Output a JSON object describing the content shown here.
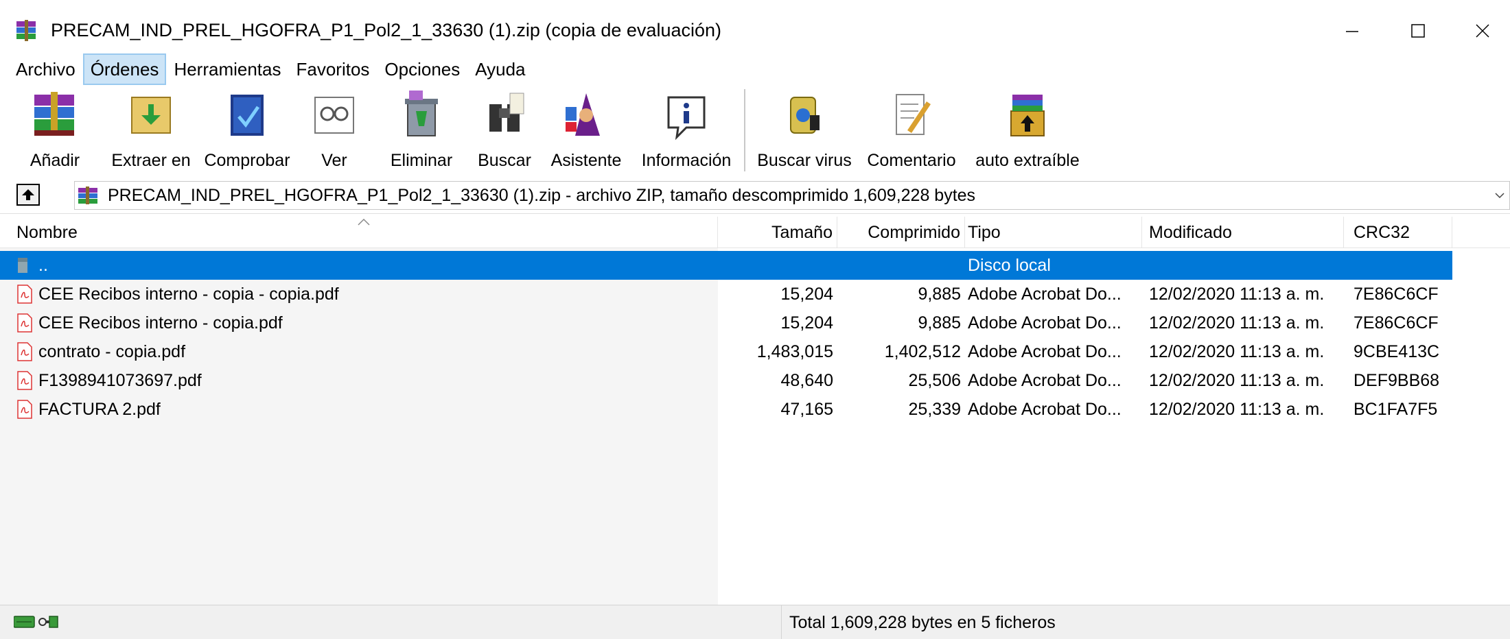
{
  "window": {
    "title": "PRECAM_IND_PREL_HGOFRA_P1_Pol2_1_33630 (1).zip (copia de evaluación)",
    "app_icon": "winrar-books-icon",
    "controls": [
      "minimize-icon",
      "maximize-icon",
      "close-icon"
    ]
  },
  "menu": [
    {
      "label": "Archivo",
      "active": false
    },
    {
      "label": "Órdenes",
      "active": true
    },
    {
      "label": "Herramientas",
      "active": false
    },
    {
      "label": "Favoritos",
      "active": false
    },
    {
      "label": "Opciones",
      "active": false
    },
    {
      "label": "Ayuda",
      "active": false
    }
  ],
  "toolbar": [
    {
      "label": "Añadir",
      "icon": "add-archive-icon"
    },
    {
      "label": "Extraer en",
      "icon": "extract-to-icon"
    },
    {
      "label": "Comprobar",
      "icon": "test-archive-icon"
    },
    {
      "label": "Ver",
      "icon": "view-glasses-icon"
    },
    {
      "label": "Eliminar",
      "icon": "delete-bin-icon"
    },
    {
      "label": "Buscar",
      "icon": "binoculars-icon"
    },
    {
      "label": "Asistente",
      "icon": "wizard-icon"
    },
    {
      "label": "Información",
      "icon": "info-icon"
    },
    {
      "label": "Buscar virus",
      "icon": "virus-scan-icon"
    },
    {
      "label": "Comentario",
      "icon": "comment-icon"
    },
    {
      "label": "auto extraíble",
      "icon": "self-extract-icon"
    }
  ],
  "address": {
    "text": "PRECAM_IND_PREL_HGOFRA_P1_Pol2_1_33630 (1).zip - archivo ZIP, tamaño descomprimido 1,609,228 bytes"
  },
  "columns": {
    "name": "Nombre",
    "size": "Tamaño",
    "packed": "Comprimido",
    "type": "Tipo",
    "modified": "Modificado",
    "crc": "CRC32"
  },
  "rows": [
    {
      "name": "..",
      "size": "",
      "packed": "",
      "type": "Disco local",
      "modified": "",
      "crc": "",
      "icon": "parent-folder-icon",
      "selected": true
    },
    {
      "name": "CEE Recibos interno - copia - copia.pdf",
      "size": "15,204",
      "packed": "9,885",
      "type": "Adobe Acrobat Do...",
      "modified": "12/02/2020 11:13 a. m.",
      "crc": "7E86C6CF",
      "icon": "pdf-file-icon",
      "selected": false
    },
    {
      "name": "CEE Recibos interno - copia.pdf",
      "size": "15,204",
      "packed": "9,885",
      "type": "Adobe Acrobat Do...",
      "modified": "12/02/2020 11:13 a. m.",
      "crc": "7E86C6CF",
      "icon": "pdf-file-icon",
      "selected": false
    },
    {
      "name": "contrato - copia.pdf",
      "size": "1,483,015",
      "packed": "1,402,512",
      "type": "Adobe Acrobat Do...",
      "modified": "12/02/2020 11:13 a. m.",
      "crc": "9CBE413C",
      "icon": "pdf-file-icon",
      "selected": false
    },
    {
      "name": "F1398941073697.pdf",
      "size": "48,640",
      "packed": "25,506",
      "type": "Adobe Acrobat Do...",
      "modified": "12/02/2020 11:13 a. m.",
      "crc": "DEF9BB68",
      "icon": "pdf-file-icon",
      "selected": false
    },
    {
      "name": "FACTURA 2.pdf",
      "size": "47,165",
      "packed": "25,339",
      "type": "Adobe Acrobat Do...",
      "modified": "12/02/2020 11:13 a. m.",
      "crc": "BC1FA7F5",
      "icon": "pdf-file-icon",
      "selected": false
    }
  ],
  "status": {
    "text": "Total 1,609,228 bytes en 5 ficheros",
    "icons": [
      "drive-icon",
      "key-icon"
    ]
  },
  "colors": {
    "selection": "#0078d7",
    "menu_active": "#cce4f7"
  }
}
